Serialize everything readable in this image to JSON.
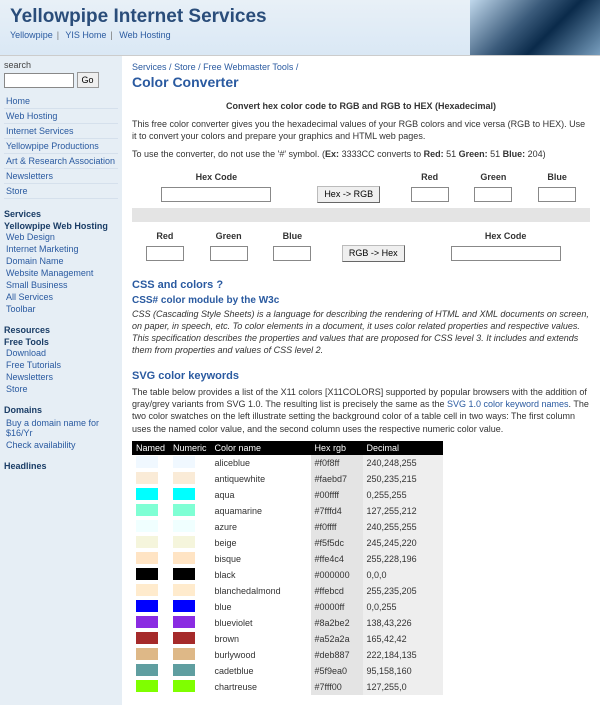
{
  "header": {
    "title": "Yellowpipe Internet Services"
  },
  "topnav": {
    "items": [
      "Yellowpipe",
      "YIS Home",
      "Web Hosting"
    ]
  },
  "sidebar": {
    "search_label": "search",
    "search_button": "Go",
    "nav": [
      "Home",
      "Web Hosting",
      "Internet Services",
      "Yellowpipe Productions",
      "Art & Research Association",
      "Newsletters",
      "Store"
    ],
    "services_h": "Services",
    "services_strong": "Yellowpipe Web Hosting",
    "services": [
      "Web Design",
      "Internet Marketing",
      "Domain Name",
      "Website Management",
      "Small Business",
      "All Services",
      "Toolbar"
    ],
    "resources_h": "Resources",
    "resources_strong": "Free Tools",
    "resources": [
      "Download",
      "Free Tutorials",
      "Newsletters",
      "Store"
    ],
    "domains_h": "Domains",
    "domain_buy": "Buy a domain name for $16/Yr",
    "domain_check": "Check availability",
    "headlines_h": "Headlines"
  },
  "breadcrumb": {
    "p1": "Services",
    "p2": "Store",
    "p3": "Free Webmaster Tools",
    "sep": "/"
  },
  "main": {
    "title": "Color Converter",
    "lead": "Convert hex color code to RGB and RGB to HEX (Hexadecimal)",
    "p1": "This free color converter gives you the hexadecimal values of your RGB colors and vice versa (RGB to HEX). Use it to convert your colors and prepare your graphics and HTML web pages.",
    "p2_a": "To use the converter, do not use the '#' symbol. (",
    "p2_ex": "Ex:",
    "p2_b": " 3333CC converts to ",
    "p2_red": "Red:",
    "p2_rv": " 51 ",
    "p2_green": "Green:",
    "p2_gv": " 51 ",
    "p2_blue": "Blue:",
    "p2_bv": " 204)"
  },
  "conv1": {
    "hex_h": "Hex Code",
    "btn": "Hex -> RGB",
    "red_h": "Red",
    "green_h": "Green",
    "blue_h": "Blue"
  },
  "conv2": {
    "red_h": "Red",
    "green_h": "Green",
    "blue_h": "Blue",
    "btn": "RGB -> Hex",
    "hex_h": "Hex Code"
  },
  "css": {
    "h": "CSS and colors ?",
    "h2": "CSS# color module by the W3c",
    "p": "CSS (Cascading Style Sheets) is a language for describing the rendering of HTML and XML documents on screen, on paper, in speech, etc. To color elements in a document, it uses color related properties and respective values. This specification describes the properties and values that are proposed for CSS level 3. It includes and extends them from properties and values of CSS level 2."
  },
  "svg": {
    "h": "SVG color keywords",
    "p_a": "The table below provides a list of the X11 colors [X11COLORS] supported by popular browsers with the addition of gray/grey variants from SVG 1.0. The resulting list is precisely the same as the ",
    "link": "SVG 1.0 color keyword names",
    "p_b": ". The two color swatches on the left illustrate setting the background color of a table cell in two ways: The first column uses the named color value, and the second column uses the respective numeric color value."
  },
  "table": {
    "h_named": "Named",
    "h_numeric": "Numeric",
    "h_name": "Color name",
    "h_hex": "Hex rgb",
    "h_dec": "Decimal",
    "rows": [
      {
        "c": "#f0f8ff",
        "name": "aliceblue",
        "hex": "#f0f8ff",
        "dec": "240,248,255"
      },
      {
        "c": "#faebd7",
        "name": "antiquewhite",
        "hex": "#faebd7",
        "dec": "250,235,215"
      },
      {
        "c": "#00ffff",
        "name": "aqua",
        "hex": "#00ffff",
        "dec": "0,255,255"
      },
      {
        "c": "#7fffd4",
        "name": "aquamarine",
        "hex": "#7fffd4",
        "dec": "127,255,212"
      },
      {
        "c": "#f0ffff",
        "name": "azure",
        "hex": "#f0ffff",
        "dec": "240,255,255"
      },
      {
        "c": "#f5f5dc",
        "name": "beige",
        "hex": "#f5f5dc",
        "dec": "245,245,220"
      },
      {
        "c": "#ffe4c4",
        "name": "bisque",
        "hex": "#ffe4c4",
        "dec": "255,228,196"
      },
      {
        "c": "#000000",
        "name": "black",
        "hex": "#000000",
        "dec": "0,0,0"
      },
      {
        "c": "#ffebcd",
        "name": "blanchedalmond",
        "hex": "#ffebcd",
        "dec": "255,235,205"
      },
      {
        "c": "#0000ff",
        "name": "blue",
        "hex": "#0000ff",
        "dec": "0,0,255"
      },
      {
        "c": "#8a2be2",
        "name": "blueviolet",
        "hex": "#8a2be2",
        "dec": "138,43,226"
      },
      {
        "c": "#a52a2a",
        "name": "brown",
        "hex": "#a52a2a",
        "dec": "165,42,42"
      },
      {
        "c": "#deb887",
        "name": "burlywood",
        "hex": "#deb887",
        "dec": "222,184,135"
      },
      {
        "c": "#5f9ea0",
        "name": "cadetblue",
        "hex": "#5f9ea0",
        "dec": "95,158,160"
      },
      {
        "c": "#7fff00",
        "name": "chartreuse",
        "hex": "#7fff00",
        "dec": "127,255,0"
      }
    ]
  }
}
